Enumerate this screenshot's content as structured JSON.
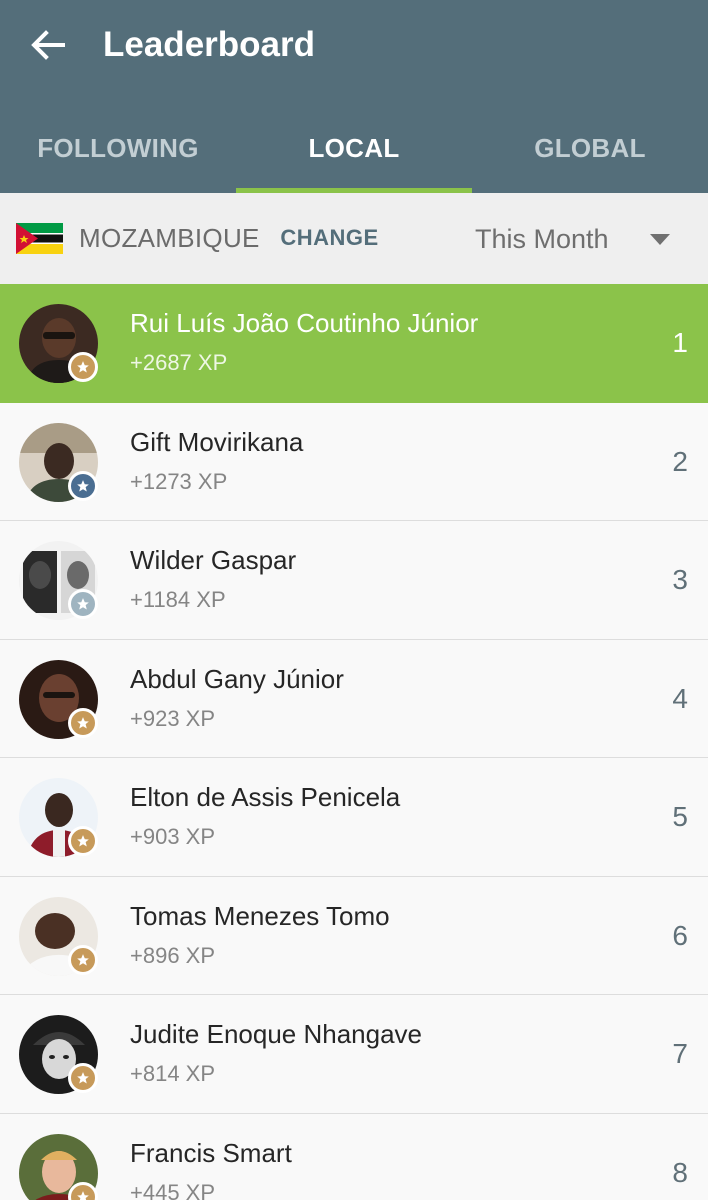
{
  "header": {
    "title": "Leaderboard",
    "back_icon": "arrow-left-icon"
  },
  "tabs": [
    {
      "label": "FOLLOWING",
      "active": false
    },
    {
      "label": "LOCAL",
      "active": true
    },
    {
      "label": "GLOBAL",
      "active": false
    }
  ],
  "filter": {
    "country": "MOZAMBIQUE",
    "flag_icon": "mozambique-flag-icon",
    "change_label": "CHANGE",
    "period": "This Month",
    "period_icon": "caret-down-icon"
  },
  "colors": {
    "header": "#546e7a",
    "accent": "#8bc34a",
    "badge_gold": "#c79a5a",
    "badge_blue": "#4b6e92",
    "badge_silver": "#9fb4c0"
  },
  "leaders": [
    {
      "rank": "1",
      "name": "Rui Luís João Coutinho Júnior",
      "xp": "+2687 XP",
      "badge": "gold"
    },
    {
      "rank": "2",
      "name": "Gift Movirikana",
      "xp": "+1273 XP",
      "badge": "blue"
    },
    {
      "rank": "3",
      "name": "Wilder Gaspar",
      "xp": "+1184 XP",
      "badge": "silver"
    },
    {
      "rank": "4",
      "name": "Abdul Gany Júnior",
      "xp": "+923 XP",
      "badge": "gold"
    },
    {
      "rank": "5",
      "name": "Elton de Assis Penicela",
      "xp": "+903 XP",
      "badge": "gold"
    },
    {
      "rank": "6",
      "name": "Tomas Menezes Tomo",
      "xp": "+896 XP",
      "badge": "gold"
    },
    {
      "rank": "7",
      "name": "Judite Enoque Nhangave",
      "xp": "+814 XP",
      "badge": "gold"
    },
    {
      "rank": "8",
      "name": "Francis Smart",
      "xp": "+445 XP",
      "badge": "gold"
    }
  ]
}
